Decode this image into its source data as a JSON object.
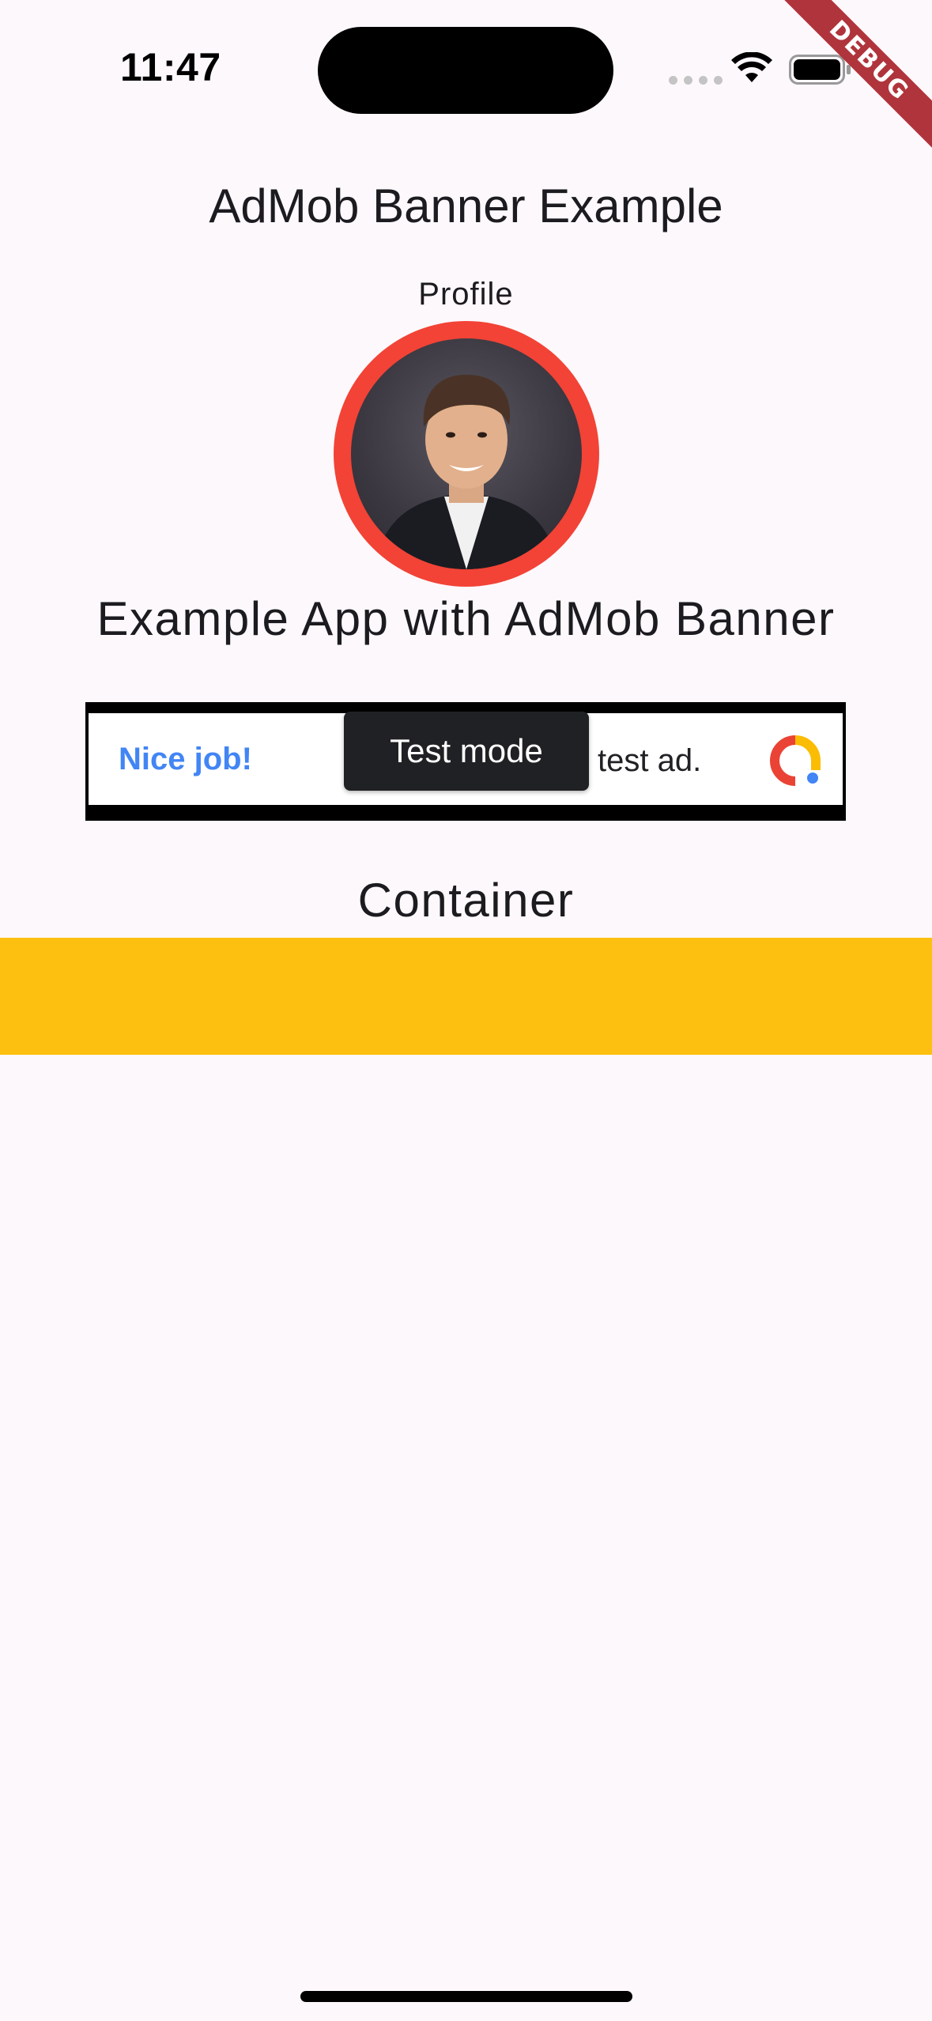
{
  "status_bar": {
    "time": "11:47"
  },
  "debug_banner": "DEBUG",
  "app": {
    "title": "AdMob Banner Example",
    "profile_label": "Profile",
    "subtitle": "Example App with AdMob Banner",
    "container_label": "Container"
  },
  "ad": {
    "headline": "Nice job!",
    "overlay": "Test mode",
    "trailing_text": "test ad."
  },
  "colors": {
    "avatar_ring": "#f24336",
    "container_bar": "#fdc010",
    "ad_headline": "#4285f4",
    "background": "#fdf8fc",
    "debug_ribbon": "#b0343c"
  },
  "icons": {
    "cellular": "cellular-signal-icon",
    "wifi": "wifi-icon",
    "battery": "battery-icon",
    "ad_logo": "admob-logo-icon"
  }
}
